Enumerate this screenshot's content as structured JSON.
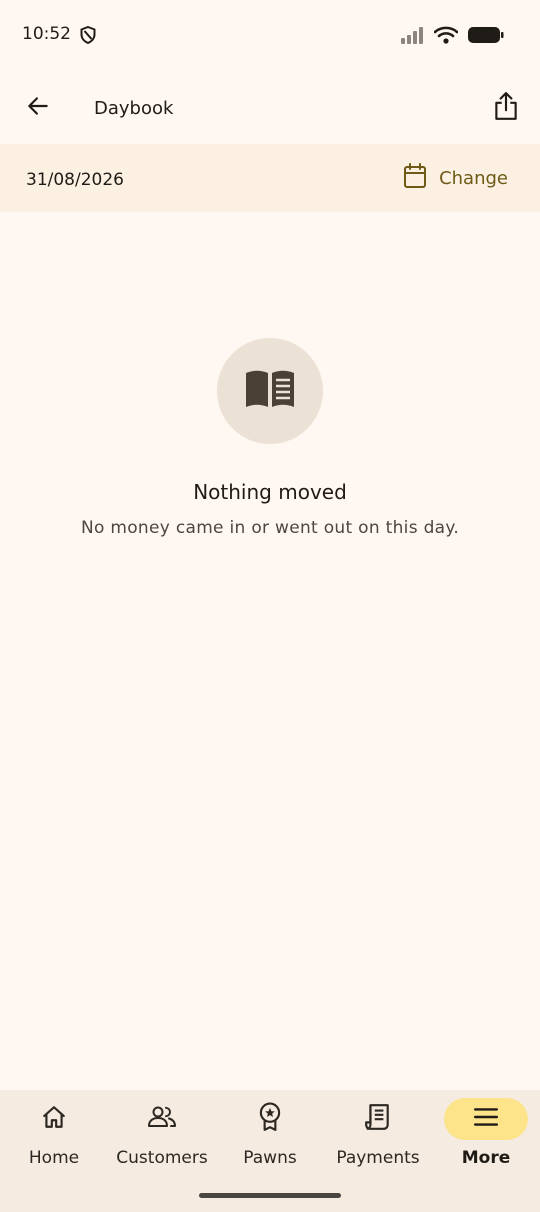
{
  "status_bar": {
    "time": "10:52",
    "icons": [
      "shield-icon",
      "signal-icon",
      "wifi-icon",
      "battery-icon"
    ]
  },
  "app_bar": {
    "title": "Daybook",
    "back_icon": "arrow-left-icon",
    "share_icon": "share-icon"
  },
  "date_bar": {
    "date": "31/08/2026",
    "change_label": "Change",
    "calendar_icon": "calendar-icon",
    "accent_color": "#6d5a16"
  },
  "empty_state": {
    "icon": "book-icon",
    "title": "Nothing moved",
    "subtitle": "No money came in or went out on this day."
  },
  "bottom_nav": {
    "items": [
      {
        "label": "Home",
        "icon": "home-icon",
        "active": false
      },
      {
        "label": "Customers",
        "icon": "people-icon",
        "active": false
      },
      {
        "label": "Pawns",
        "icon": "badge-icon",
        "active": false
      },
      {
        "label": "Payments",
        "icon": "receipt-icon",
        "active": false
      },
      {
        "label": "More",
        "icon": "menu-icon",
        "active": true
      }
    ],
    "active_color": "#fde38a"
  }
}
